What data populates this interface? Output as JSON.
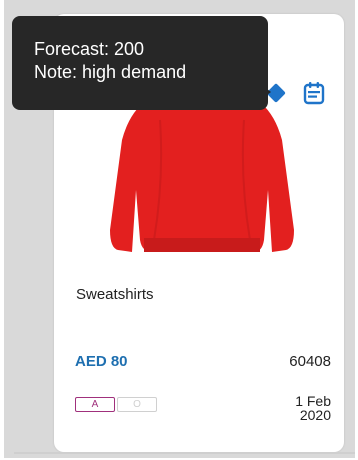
{
  "tooltip": {
    "line1": "Forecast: 200",
    "line2": "Note: high demand"
  },
  "product": {
    "name": "Sweatshirts",
    "price": "AED 80",
    "code": "60408",
    "badge_a": "A",
    "badge_o": "O",
    "date_line1": "1 Feb",
    "date_line2": "2020",
    "image_color": "#e3201f"
  },
  "icons": {
    "calendar": "calendar-icon"
  },
  "colors": {
    "price": "#1e6fb0",
    "accent": "#1f74c9",
    "badge_a": "#a0307c",
    "tooltip_bg": "#272727"
  }
}
